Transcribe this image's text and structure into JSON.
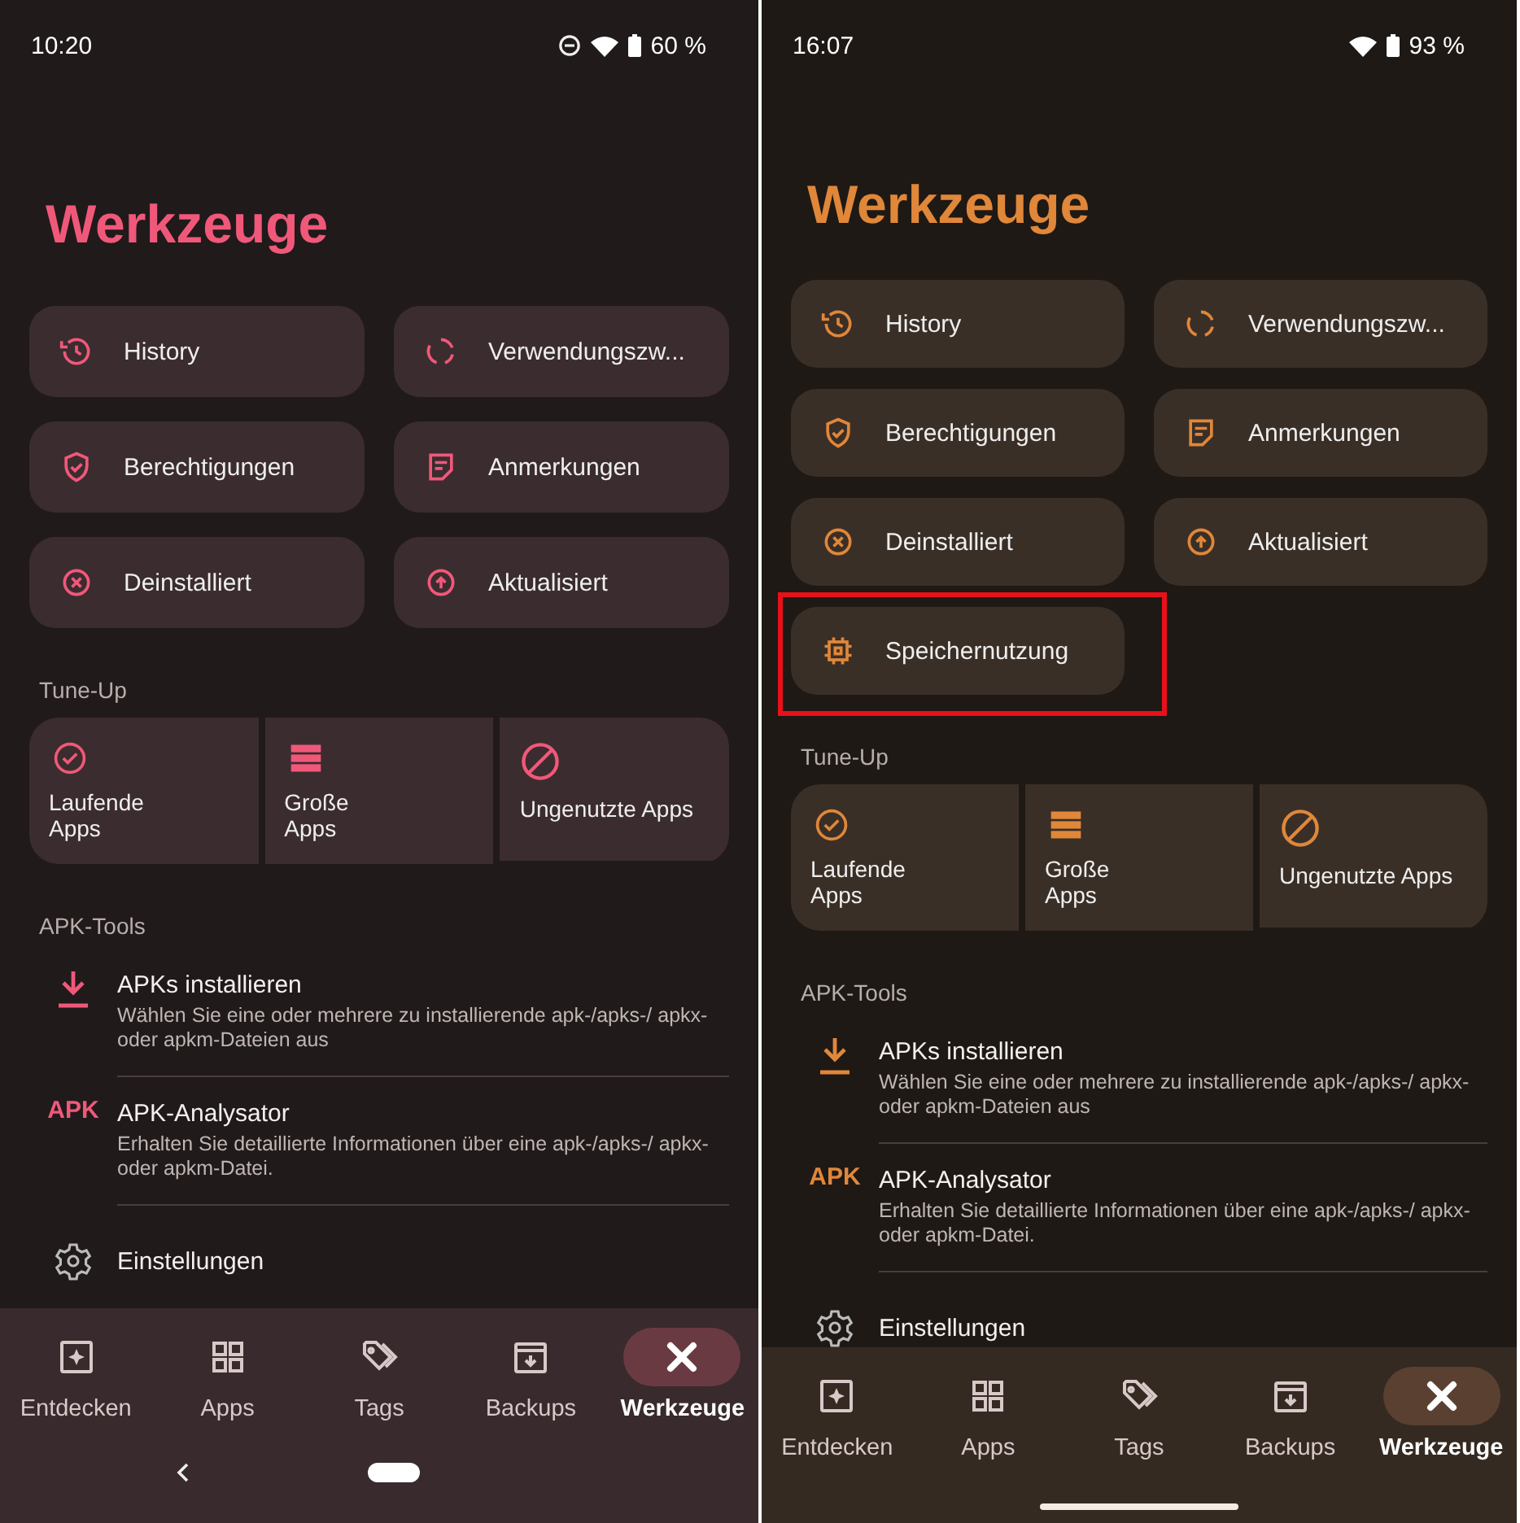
{
  "screens": [
    {
      "color": "#f0587a",
      "status_bar": {
        "time": "10:20",
        "dnd": true,
        "battery": "60 %"
      },
      "title": "Werkzeuge",
      "tools": [
        {
          "label": "History",
          "kind": "history",
          "highlighted": false
        },
        {
          "label": "Verwendungszw...",
          "kind": "ring",
          "highlighted": false
        },
        {
          "label": "Berechtigungen",
          "kind": "shield",
          "highlighted": false
        },
        {
          "label": "Anmerkungen",
          "kind": "note",
          "highlighted": false
        },
        {
          "label": "Deinstalliert",
          "kind": "xcircle",
          "highlighted": false
        },
        {
          "label": "Aktualisiert",
          "kind": "upcircle",
          "highlighted": false
        }
      ],
      "tune_up": {
        "heading": "Tune-Up",
        "items": [
          {
            "label": "Laufende\nApps",
            "kind": "check"
          },
          {
            "label": "Große\nApps",
            "kind": "storage"
          },
          {
            "label": "Ungenutzte Apps",
            "kind": "block"
          }
        ]
      },
      "apk_tools": {
        "heading": "APK-Tools",
        "items": [
          {
            "title": "APKs installieren",
            "description": "Wählen Sie eine oder mehrere zu installierende apk-/apks-/ apkx- oder apkm-Dateien aus",
            "kind": "download"
          },
          {
            "title": "APK-Analysator",
            "description": "Erhalten Sie detaillierte Informationen über eine apk-/apks-/ apkx- oder apkm-Datei.",
            "kind": "apk",
            "icon_text": "APK"
          }
        ]
      },
      "settings": "Einstellungen",
      "nav": [
        {
          "label": "Entdecken",
          "kind": "explore",
          "selected": false
        },
        {
          "label": "Apps",
          "kind": "grid",
          "selected": false
        },
        {
          "label": "Tags",
          "kind": "tag",
          "selected": false
        },
        {
          "label": "Backups",
          "kind": "archive",
          "selected": false
        },
        {
          "label": "Werkzeuge",
          "kind": "tools",
          "selected": true
        }
      ],
      "system_nav": {
        "kind": "buttons"
      }
    },
    {
      "color": "#e0873a",
      "status_bar": {
        "time": "16:07",
        "dnd": false,
        "battery": "93 %"
      },
      "title": "Werkzeuge",
      "tools": [
        {
          "label": "History",
          "kind": "history",
          "highlighted": false
        },
        {
          "label": "Verwendungszw...",
          "kind": "ring",
          "highlighted": false
        },
        {
          "label": "Berechtigungen",
          "kind": "shield",
          "highlighted": false
        },
        {
          "label": "Anmerkungen",
          "kind": "note",
          "highlighted": false
        },
        {
          "label": "Deinstalliert",
          "kind": "xcircle",
          "highlighted": false
        },
        {
          "label": "Aktualisiert",
          "kind": "upcircle",
          "highlighted": false
        },
        {
          "label": "Speichernutzung",
          "kind": "chip",
          "highlighted": true
        }
      ],
      "tune_up": {
        "heading": "Tune-Up",
        "items": [
          {
            "label": "Laufende\nApps",
            "kind": "check"
          },
          {
            "label": "Große\nApps",
            "kind": "storage"
          },
          {
            "label": "Ungenutzte Apps",
            "kind": "block"
          }
        ]
      },
      "apk_tools": {
        "heading": "APK-Tools",
        "items": [
          {
            "title": "APKs installieren",
            "description": "Wählen Sie eine oder mehrere zu installierende apk-/apks-/ apkx- oder apkm-Dateien aus",
            "kind": "download"
          },
          {
            "title": "APK-Analysator",
            "description": "Erhalten Sie detaillierte Informationen über eine apk-/apks-/ apkx- oder apkm-Datei.",
            "kind": "apk",
            "icon_text": "APK"
          }
        ]
      },
      "settings": "Einstellungen",
      "nav": [
        {
          "label": "Entdecken",
          "kind": "explore",
          "selected": false
        },
        {
          "label": "Apps",
          "kind": "grid",
          "selected": false
        },
        {
          "label": "Tags",
          "kind": "tag",
          "selected": false
        },
        {
          "label": "Backups",
          "kind": "archive",
          "selected": false
        },
        {
          "label": "Werkzeuge",
          "kind": "tools",
          "selected": true
        }
      ],
      "system_nav": {
        "kind": "gesture"
      }
    }
  ]
}
